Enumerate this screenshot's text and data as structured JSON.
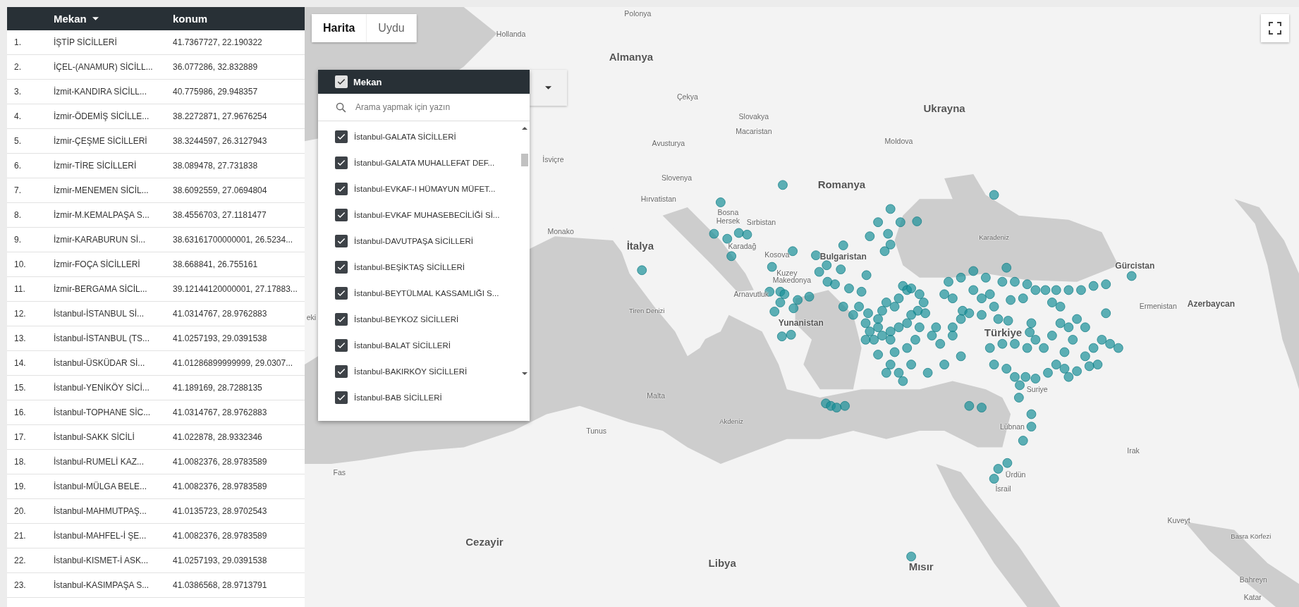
{
  "table": {
    "columns": [
      {
        "label": "Mekan",
        "sorted": true
      },
      {
        "label": "konum",
        "sorted": false
      }
    ],
    "rows": [
      {
        "index": "1.",
        "mekan": "İŞTİP SİCİLLERİ",
        "konum": "41.7367727, 22.190322"
      },
      {
        "index": "2.",
        "mekan": "İÇEL-(ANAMUR) SİCİLL...",
        "konum": "36.077286, 32.832889"
      },
      {
        "index": "3.",
        "mekan": "İzmit-KANDIRA SİCİLL...",
        "konum": "40.775986, 29.948357"
      },
      {
        "index": "4.",
        "mekan": "İzmir-ÖDEMİŞ SİCİLLE...",
        "konum": "38.2272871, 27.9676254"
      },
      {
        "index": "5.",
        "mekan": "İzmir-ÇEŞME SİCİLLERİ",
        "konum": "38.3244597, 26.3127943"
      },
      {
        "index": "6.",
        "mekan": "İzmir-TİRE SİCİLLERİ",
        "konum": "38.089478, 27.731838"
      },
      {
        "index": "7.",
        "mekan": "İzmir-MENEMEN SİCİL...",
        "konum": "38.6092559, 27.0694804"
      },
      {
        "index": "8.",
        "mekan": "İzmir-M.KEMALPAŞA S...",
        "konum": "38.4556703, 27.1181477"
      },
      {
        "index": "9.",
        "mekan": "İzmir-KARABURUN Sİ...",
        "konum": "38.63161700000001, 26.5234..."
      },
      {
        "index": "10.",
        "mekan": "İzmir-FOÇA SİCİLLERİ",
        "konum": "38.668841, 26.755161"
      },
      {
        "index": "11.",
        "mekan": "İzmir-BERGAMA SİCİL...",
        "konum": "39.12144120000001, 27.17883..."
      },
      {
        "index": "12.",
        "mekan": "İstanbul-İSTANBUL Sİ...",
        "konum": "41.0314767, 28.9762883"
      },
      {
        "index": "13.",
        "mekan": "İstanbul-İSTANBUL (TS...",
        "konum": "41.0257193, 29.0391538"
      },
      {
        "index": "14.",
        "mekan": "İstanbul-ÜSKÜDAR Sİ...",
        "konum": "41.01286899999999, 29.0307..."
      },
      {
        "index": "15.",
        "mekan": "İstanbul-YENİKÖY SİCİ...",
        "konum": "41.189169, 28.7288135"
      },
      {
        "index": "16.",
        "mekan": "İstanbul-TOPHANE SİC...",
        "konum": "41.0314767, 28.9762883"
      },
      {
        "index": "17.",
        "mekan": "İstanbul-SAKK SİCİLİ",
        "konum": "41.022878, 28.9332346"
      },
      {
        "index": "18.",
        "mekan": "İstanbul-RUMELİ KAZ...",
        "konum": "41.0082376, 28.9783589"
      },
      {
        "index": "19.",
        "mekan": "İstanbul-MÜLGA BELE...",
        "konum": "41.0082376, 28.9783589"
      },
      {
        "index": "20.",
        "mekan": "İstanbul-MAHMUTPAŞ...",
        "konum": "41.0135723, 28.9702543"
      },
      {
        "index": "21.",
        "mekan": "İstanbul-MAHFEL-İ ŞE...",
        "konum": "41.0082376, 28.9783589"
      },
      {
        "index": "22.",
        "mekan": "İstanbul-KISMET-İ ASK...",
        "konum": "41.0257193, 29.0391538"
      },
      {
        "index": "23.",
        "mekan": "İstanbul-KASIMPAŞA S...",
        "konum": "41.0386568, 28.9713791"
      }
    ]
  },
  "map": {
    "map_type_tabs": [
      {
        "label": "Harita",
        "selected": true
      },
      {
        "label": "Uydu",
        "selected": false
      }
    ],
    "filter": {
      "label": "Mekan",
      "checked": true,
      "search_placeholder": "Arama yapmak için yazın",
      "items": [
        {
          "label": "İstanbul-GALATA SİCİLLERİ",
          "checked": true
        },
        {
          "label": "İstanbul-GALATA MUHALLEFAT DEF...",
          "checked": true
        },
        {
          "label": "İstanbul-EVKAF-I HÜMAYUN MÜFET...",
          "checked": true
        },
        {
          "label": "İstanbul-EVKAF MUHASEBECİLİĞİ Sİ...",
          "checked": true
        },
        {
          "label": "İstanbul-DAVUTPAŞA SİCİLLERİ",
          "checked": true
        },
        {
          "label": "İstanbul-BEŞİKTAŞ SİCİLLERİ",
          "checked": true
        },
        {
          "label": "İstanbul-BEYTÜLMAL KASSAMLIĞI S...",
          "checked": true
        },
        {
          "label": "İstanbul-BEYKOZ SİCİLLERİ",
          "checked": true
        },
        {
          "label": "İstanbul-BALAT SİCİLLERİ",
          "checked": true
        },
        {
          "label": "İstanbul-BAKIRKÖY SİCİLLERİ",
          "checked": true
        },
        {
          "label": "İstanbul-BAB SİCİLLERİ",
          "checked": true
        }
      ]
    },
    "labels": [
      {
        "text": "Polonya",
        "kind": "country"
      },
      {
        "text": "Hollanda",
        "kind": "country"
      },
      {
        "text": "Almanya",
        "kind": "major"
      },
      {
        "text": "Çekya",
        "kind": "country"
      },
      {
        "text": "Slovakya",
        "kind": "country"
      },
      {
        "text": "Ukrayna",
        "kind": "major"
      },
      {
        "text": "Avusturya",
        "kind": "country"
      },
      {
        "text": "Macaristan",
        "kind": "country"
      },
      {
        "text": "Moldova",
        "kind": "country"
      },
      {
        "text": "İsviçre",
        "kind": "country"
      },
      {
        "text": "Slovenya",
        "kind": "country"
      },
      {
        "text": "Romanya",
        "kind": "major"
      },
      {
        "text": "Hırvatistan",
        "kind": "country"
      },
      {
        "text": "Bosna",
        "kind": "country"
      },
      {
        "text": "Hersek",
        "kind": "country"
      },
      {
        "text": "Sırbistan",
        "kind": "country"
      },
      {
        "text": "Monako",
        "kind": "country"
      },
      {
        "text": "Karadeniz",
        "kind": "sea"
      },
      {
        "text": "İtalya",
        "kind": "major"
      },
      {
        "text": "Karadağ",
        "kind": "country"
      },
      {
        "text": "Kosova",
        "kind": "country"
      },
      {
        "text": "Bulgaristan",
        "kind": "medium"
      },
      {
        "text": "Kuzey",
        "kind": "country"
      },
      {
        "text": "Makedonya",
        "kind": "country"
      },
      {
        "text": "Gürcistan",
        "kind": "medium"
      },
      {
        "text": "Arnavutluk",
        "kind": "country"
      },
      {
        "text": "Ermenistan",
        "kind": "country"
      },
      {
        "text": "Azerbaycan",
        "kind": "medium"
      },
      {
        "text": "Tiren Denizi",
        "kind": "sea"
      },
      {
        "text": "Yunanistan",
        "kind": "medium"
      },
      {
        "text": "Türkiye",
        "kind": "major"
      },
      {
        "text": "eki",
        "kind": "country"
      },
      {
        "text": "Malta",
        "kind": "country"
      },
      {
        "text": "Suriye",
        "kind": "country"
      },
      {
        "text": "Akdeniz",
        "kind": "sea"
      },
      {
        "text": "Lübnan",
        "kind": "country"
      },
      {
        "text": "Tunus",
        "kind": "country"
      },
      {
        "text": "Irak",
        "kind": "country"
      },
      {
        "text": "Fas",
        "kind": "country"
      },
      {
        "text": "Ürdün",
        "kind": "country"
      },
      {
        "text": "İsrail",
        "kind": "country"
      },
      {
        "text": "Kuveyt",
        "kind": "country"
      },
      {
        "text": "Basra Körfezi",
        "kind": "sea"
      },
      {
        "text": "Cezayir",
        "kind": "major"
      },
      {
        "text": "Libya",
        "kind": "major"
      },
      {
        "text": "Mısır",
        "kind": "major"
      },
      {
        "text": "Bahreyn",
        "kind": "country"
      },
      {
        "text": "Katar",
        "kind": "country"
      }
    ]
  }
}
